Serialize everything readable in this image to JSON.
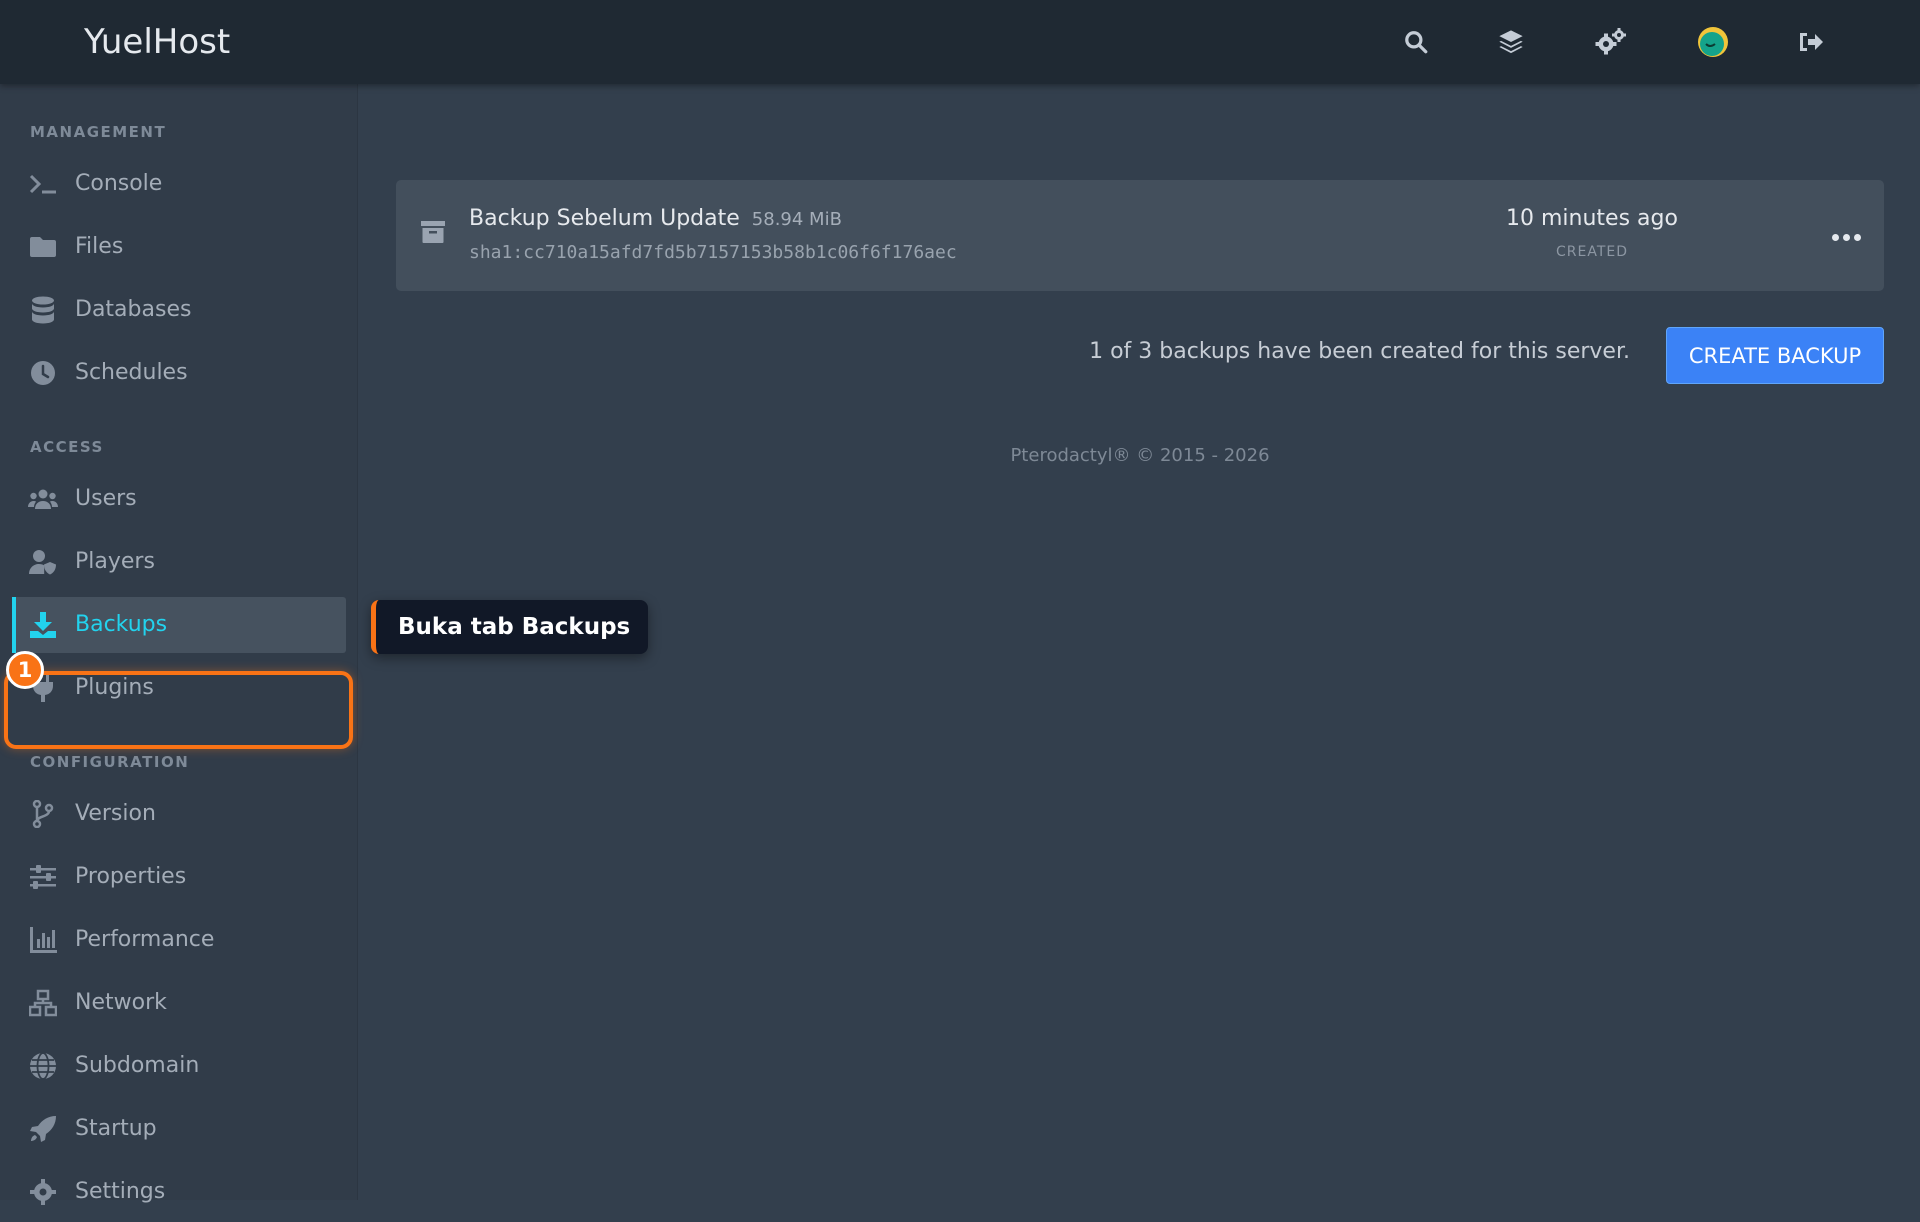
{
  "app": {
    "brand": "YuelHost"
  },
  "sidebar": {
    "sections": {
      "management": "MANAGEMENT",
      "access": "ACCESS",
      "configuration": "CONFIGURATION"
    },
    "items": [
      {
        "label": "Console",
        "icon": "terminal-icon"
      },
      {
        "label": "Files",
        "icon": "folder-icon"
      },
      {
        "label": "Databases",
        "icon": "database-icon"
      },
      {
        "label": "Schedules",
        "icon": "clock-icon"
      },
      {
        "label": "Users",
        "icon": "users-icon"
      },
      {
        "label": "Players",
        "icon": "user-shield-icon"
      },
      {
        "label": "Backups",
        "icon": "download-icon",
        "active": true
      },
      {
        "label": "Plugins",
        "icon": "plug-icon"
      },
      {
        "label": "Version",
        "icon": "code-branch-icon"
      },
      {
        "label": "Properties",
        "icon": "sliders-icon"
      },
      {
        "label": "Performance",
        "icon": "bar-chart-icon"
      },
      {
        "label": "Network",
        "icon": "network-icon"
      },
      {
        "label": "Subdomain",
        "icon": "globe-icon"
      },
      {
        "label": "Startup",
        "icon": "rocket-icon"
      },
      {
        "label": "Settings",
        "icon": "gear-icon"
      }
    ]
  },
  "annotation": {
    "step": "1",
    "tooltip": "Buka tab Backups"
  },
  "backup": {
    "name": "Backup Sebelum Update",
    "size": "58.94 MiB",
    "hash": "sha1:cc710a15afd7fd5b7157153b58b1c06f6f176aec",
    "time": "10 minutes ago",
    "created_label": "CREATED"
  },
  "summary": "1 of 3 backups have been created for this server.",
  "create_button": "CREATE BACKUP",
  "footer": "Pterodactyl® © 2015 - 2026",
  "colors": {
    "accent": "#22d3ee",
    "highlight": "#f97316",
    "primary": "#3b82f6"
  }
}
